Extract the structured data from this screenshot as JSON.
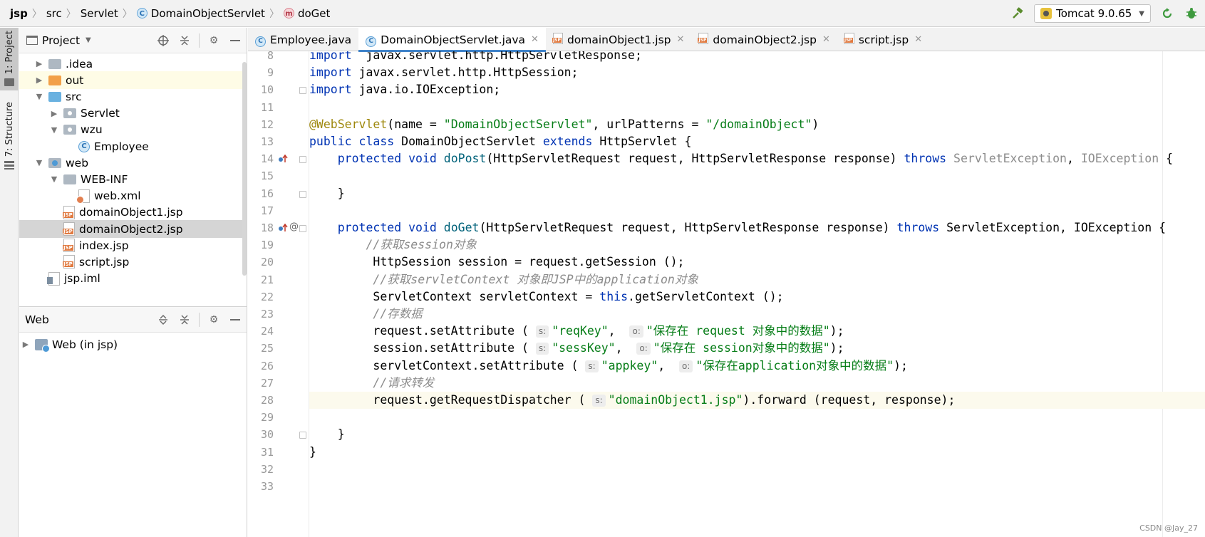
{
  "navbar": {
    "breadcrumbs": [
      {
        "label": "jsp",
        "icon": null,
        "bold": true
      },
      {
        "label": "src",
        "icon": null
      },
      {
        "label": "Servlet",
        "icon": null
      },
      {
        "label": "DomainObjectServlet",
        "icon": "class-icon"
      },
      {
        "label": "doGet",
        "icon": "method-icon"
      }
    ],
    "run_config": "Tomcat 9.0.65"
  },
  "left_strip": {
    "project_tab": "1: Project",
    "structure_tab": "7: Structure"
  },
  "project_panel": {
    "title": "Project",
    "tree": [
      {
        "label": ".idea",
        "icon": "folder-gray",
        "depth": 1,
        "arrow": "right"
      },
      {
        "label": "out",
        "icon": "folder-orange",
        "depth": 1,
        "arrow": "right",
        "highlight": true
      },
      {
        "label": "src",
        "icon": "folder-blue",
        "depth": 1,
        "arrow": "down"
      },
      {
        "label": "Servlet",
        "icon": "package",
        "depth": 2,
        "arrow": "right"
      },
      {
        "label": "wzu",
        "icon": "package",
        "depth": 2,
        "arrow": "down"
      },
      {
        "label": "Employee",
        "icon": "class",
        "depth": 3,
        "arrow": null
      },
      {
        "label": "web",
        "icon": "web-folder",
        "depth": 1,
        "arrow": "down"
      },
      {
        "label": "WEB-INF",
        "icon": "folder-gray",
        "depth": 2,
        "arrow": "down"
      },
      {
        "label": "web.xml",
        "icon": "xml",
        "depth": 3,
        "arrow": null
      },
      {
        "label": "domainObject1.jsp",
        "icon": "jsp",
        "depth": 2,
        "arrow": null
      },
      {
        "label": "domainObject2.jsp",
        "icon": "jsp",
        "depth": 2,
        "arrow": null,
        "selected": true
      },
      {
        "label": "index.jsp",
        "icon": "jsp",
        "depth": 2,
        "arrow": null
      },
      {
        "label": "script.jsp",
        "icon": "jsp",
        "depth": 2,
        "arrow": null
      },
      {
        "label": "jsp.iml",
        "icon": "iml",
        "depth": 1,
        "arrow": null
      }
    ]
  },
  "web_panel": {
    "title": "Web",
    "tree": [
      {
        "label": "Web (in jsp)",
        "icon": "web",
        "arrow": "right"
      }
    ]
  },
  "editor": {
    "tabs": [
      {
        "label": "Employee.java",
        "icon": "class",
        "active": false,
        "closable": false
      },
      {
        "label": "DomainObjectServlet.java",
        "icon": "class",
        "active": true,
        "closable": true
      },
      {
        "label": "domainObject1.jsp",
        "icon": "jsp",
        "active": false,
        "closable": true
      },
      {
        "label": "domainObject2.jsp",
        "icon": "jsp",
        "active": false,
        "closable": true
      },
      {
        "label": "script.jsp",
        "icon": "jsp",
        "active": false,
        "closable": true
      }
    ],
    "current_line": 28,
    "lines": [
      {
        "n": "8",
        "tokens": [
          [
            "kw",
            "import"
          ],
          [
            "",
            "  javax.servlet.http.HttpServletResponse;"
          ]
        ]
      },
      {
        "n": "9",
        "tokens": [
          [
            "kw",
            "import"
          ],
          [
            "",
            " javax.servlet.http.HttpSession;"
          ]
        ]
      },
      {
        "n": "10",
        "tokens": [
          [
            "kw",
            "import"
          ],
          [
            "",
            " java.io.IOException;"
          ]
        ]
      },
      {
        "n": "11",
        "tokens": []
      },
      {
        "n": "12",
        "tokens": [
          [
            "ann",
            "@WebServlet"
          ],
          [
            "",
            "(name = "
          ],
          [
            "str",
            "\"DomainObjectServlet\""
          ],
          [
            "",
            ", urlPatterns = "
          ],
          [
            "str",
            "\"/domainObject\""
          ],
          [
            "",
            ")"
          ]
        ]
      },
      {
        "n": "13",
        "tokens": [
          [
            "kw",
            "public class"
          ],
          [
            "",
            " DomainObjectServlet "
          ],
          [
            "kw",
            "extends"
          ],
          [
            "",
            " HttpServlet {"
          ]
        ]
      },
      {
        "n": "14",
        "tokens": [
          [
            "",
            "    "
          ],
          [
            "kw",
            "protected void"
          ],
          [
            "",
            " "
          ],
          [
            "fn",
            "doPost"
          ],
          [
            "",
            "(HttpServletRequest request, HttpServletResponse response) "
          ],
          [
            "kw",
            "throws"
          ],
          [
            "",
            " "
          ],
          [
            "gr",
            "ServletException"
          ],
          [
            "",
            ", "
          ],
          [
            "gr",
            "IOException"
          ],
          [
            "",
            " {"
          ]
        ]
      },
      {
        "n": "15",
        "tokens": []
      },
      {
        "n": "16",
        "tokens": [
          [
            "",
            "    }"
          ]
        ]
      },
      {
        "n": "17",
        "tokens": []
      },
      {
        "n": "18",
        "tokens": [
          [
            "",
            "    "
          ],
          [
            "kw",
            "protected void"
          ],
          [
            "",
            " "
          ],
          [
            "fn",
            "doGet"
          ],
          [
            "",
            "(HttpServletRequest request, HttpServletResponse response) "
          ],
          [
            "kw",
            "throws"
          ],
          [
            "",
            " ServletException, IOException {"
          ]
        ]
      },
      {
        "n": "19",
        "tokens": [
          [
            "",
            "        "
          ],
          [
            "cm",
            "//获取session对象"
          ]
        ]
      },
      {
        "n": "20",
        "tokens": [
          [
            "",
            "         HttpSession session = request.getSession ();"
          ]
        ]
      },
      {
        "n": "21",
        "tokens": [
          [
            "",
            "         "
          ],
          [
            "cm",
            "//获取servletContext 对象即JSP中的application对象"
          ]
        ]
      },
      {
        "n": "22",
        "tokens": [
          [
            "",
            "         ServletContext servletContext = "
          ],
          [
            "kw",
            "this"
          ],
          [
            "",
            ".getServletContext ();"
          ]
        ]
      },
      {
        "n": "23",
        "tokens": [
          [
            "",
            "         "
          ],
          [
            "cm",
            "//存数据"
          ]
        ]
      },
      {
        "n": "24",
        "tokens": [
          [
            "",
            "         request.setAttribute ( "
          ],
          [
            "hint",
            "s:"
          ],
          [
            "str",
            "\"reqKey\""
          ],
          [
            "",
            ",  "
          ],
          [
            "hint",
            "o:"
          ],
          [
            "str",
            "\"保存在 request 对象中的数据\""
          ],
          [
            "",
            ");"
          ]
        ]
      },
      {
        "n": "25",
        "tokens": [
          [
            "",
            "         session.setAttribute ( "
          ],
          [
            "hint",
            "s:"
          ],
          [
            "str",
            "\"sessKey\""
          ],
          [
            "",
            ",  "
          ],
          [
            "hint",
            "o:"
          ],
          [
            "str",
            "\"保存在 session对象中的数据\""
          ],
          [
            "",
            ");"
          ]
        ]
      },
      {
        "n": "26",
        "tokens": [
          [
            "",
            "         servletContext.setAttribute ( "
          ],
          [
            "hint",
            "s:"
          ],
          [
            "str",
            "\"appkey\""
          ],
          [
            "",
            ",  "
          ],
          [
            "hint",
            "o:"
          ],
          [
            "str",
            "\"保存在application对象中的数据\""
          ],
          [
            "",
            ");"
          ]
        ]
      },
      {
        "n": "27",
        "tokens": [
          [
            "",
            "         "
          ],
          [
            "cm",
            "//请求转发"
          ]
        ]
      },
      {
        "n": "28",
        "tokens": [
          [
            "",
            "         request.getRequestDispatcher ( "
          ],
          [
            "hint",
            "s:"
          ],
          [
            "str",
            "\"domainObject1.jsp\""
          ],
          [
            "",
            ").forward (request, response);"
          ]
        ]
      },
      {
        "n": "29",
        "tokens": []
      },
      {
        "n": "30",
        "tokens": [
          [
            "",
            "    }"
          ]
        ]
      },
      {
        "n": "31",
        "tokens": [
          [
            "",
            "}"
          ]
        ]
      },
      {
        "n": "32",
        "tokens": []
      },
      {
        "n": "33",
        "tokens": []
      }
    ]
  },
  "watermark": "CSDN @Jay_27",
  "colors": {
    "keyword": "#0033b3",
    "string": "#067d17",
    "annotation": "#9e880d",
    "method": "#00627a",
    "comment": "#8c8c8c",
    "accent": "#4083c9"
  }
}
